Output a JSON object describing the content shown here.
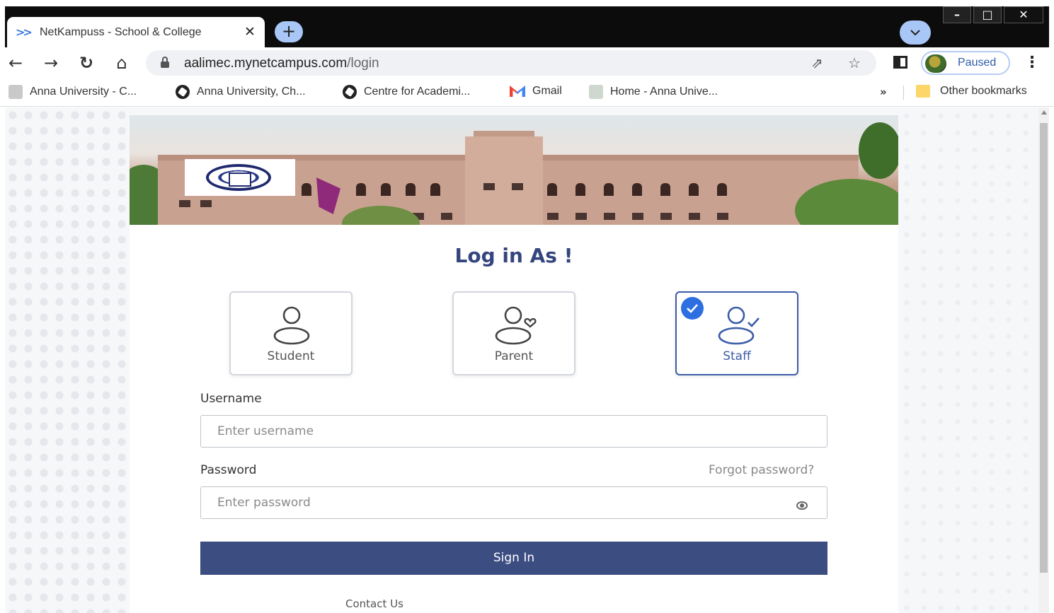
{
  "browser": {
    "tab_title": "NetKampuss - School & College",
    "tab_close": "✕",
    "new_tab": "+",
    "url_host": "aalimec.mynetcampus.com",
    "url_path": "/login",
    "profile_status": "Paused",
    "window_controls": [
      "–",
      "□",
      "✕"
    ],
    "bookmarks": [
      {
        "label": "Anna University - C...",
        "icon": "emblem-icon"
      },
      {
        "label": "Anna University, Ch...",
        "icon": "globe-icon"
      },
      {
        "label": "Centre for Academi...",
        "icon": "globe-icon"
      },
      {
        "label": "Gmail",
        "icon": "gmail-icon"
      },
      {
        "label": "Home - Anna Unive...",
        "icon": "emblem-icon"
      }
    ],
    "overflow": "»",
    "other_bookmarks": "Other bookmarks"
  },
  "login": {
    "heading": "Log in As !",
    "roles": [
      {
        "label": "Student",
        "selected": false
      },
      {
        "label": "Parent",
        "selected": false
      },
      {
        "label": "Staff",
        "selected": true
      }
    ],
    "username_label": "Username",
    "username_placeholder": "Enter username",
    "password_label": "Password",
    "forgot_password": "Forgot password?",
    "password_placeholder": "Enter password",
    "sign_in": "Sign In",
    "contact": "Contact Us"
  },
  "colors": {
    "accent": "#3c4d82",
    "heading": "#35457d",
    "selected_border": "#3b5ca8",
    "check": "#2d6fe0"
  }
}
